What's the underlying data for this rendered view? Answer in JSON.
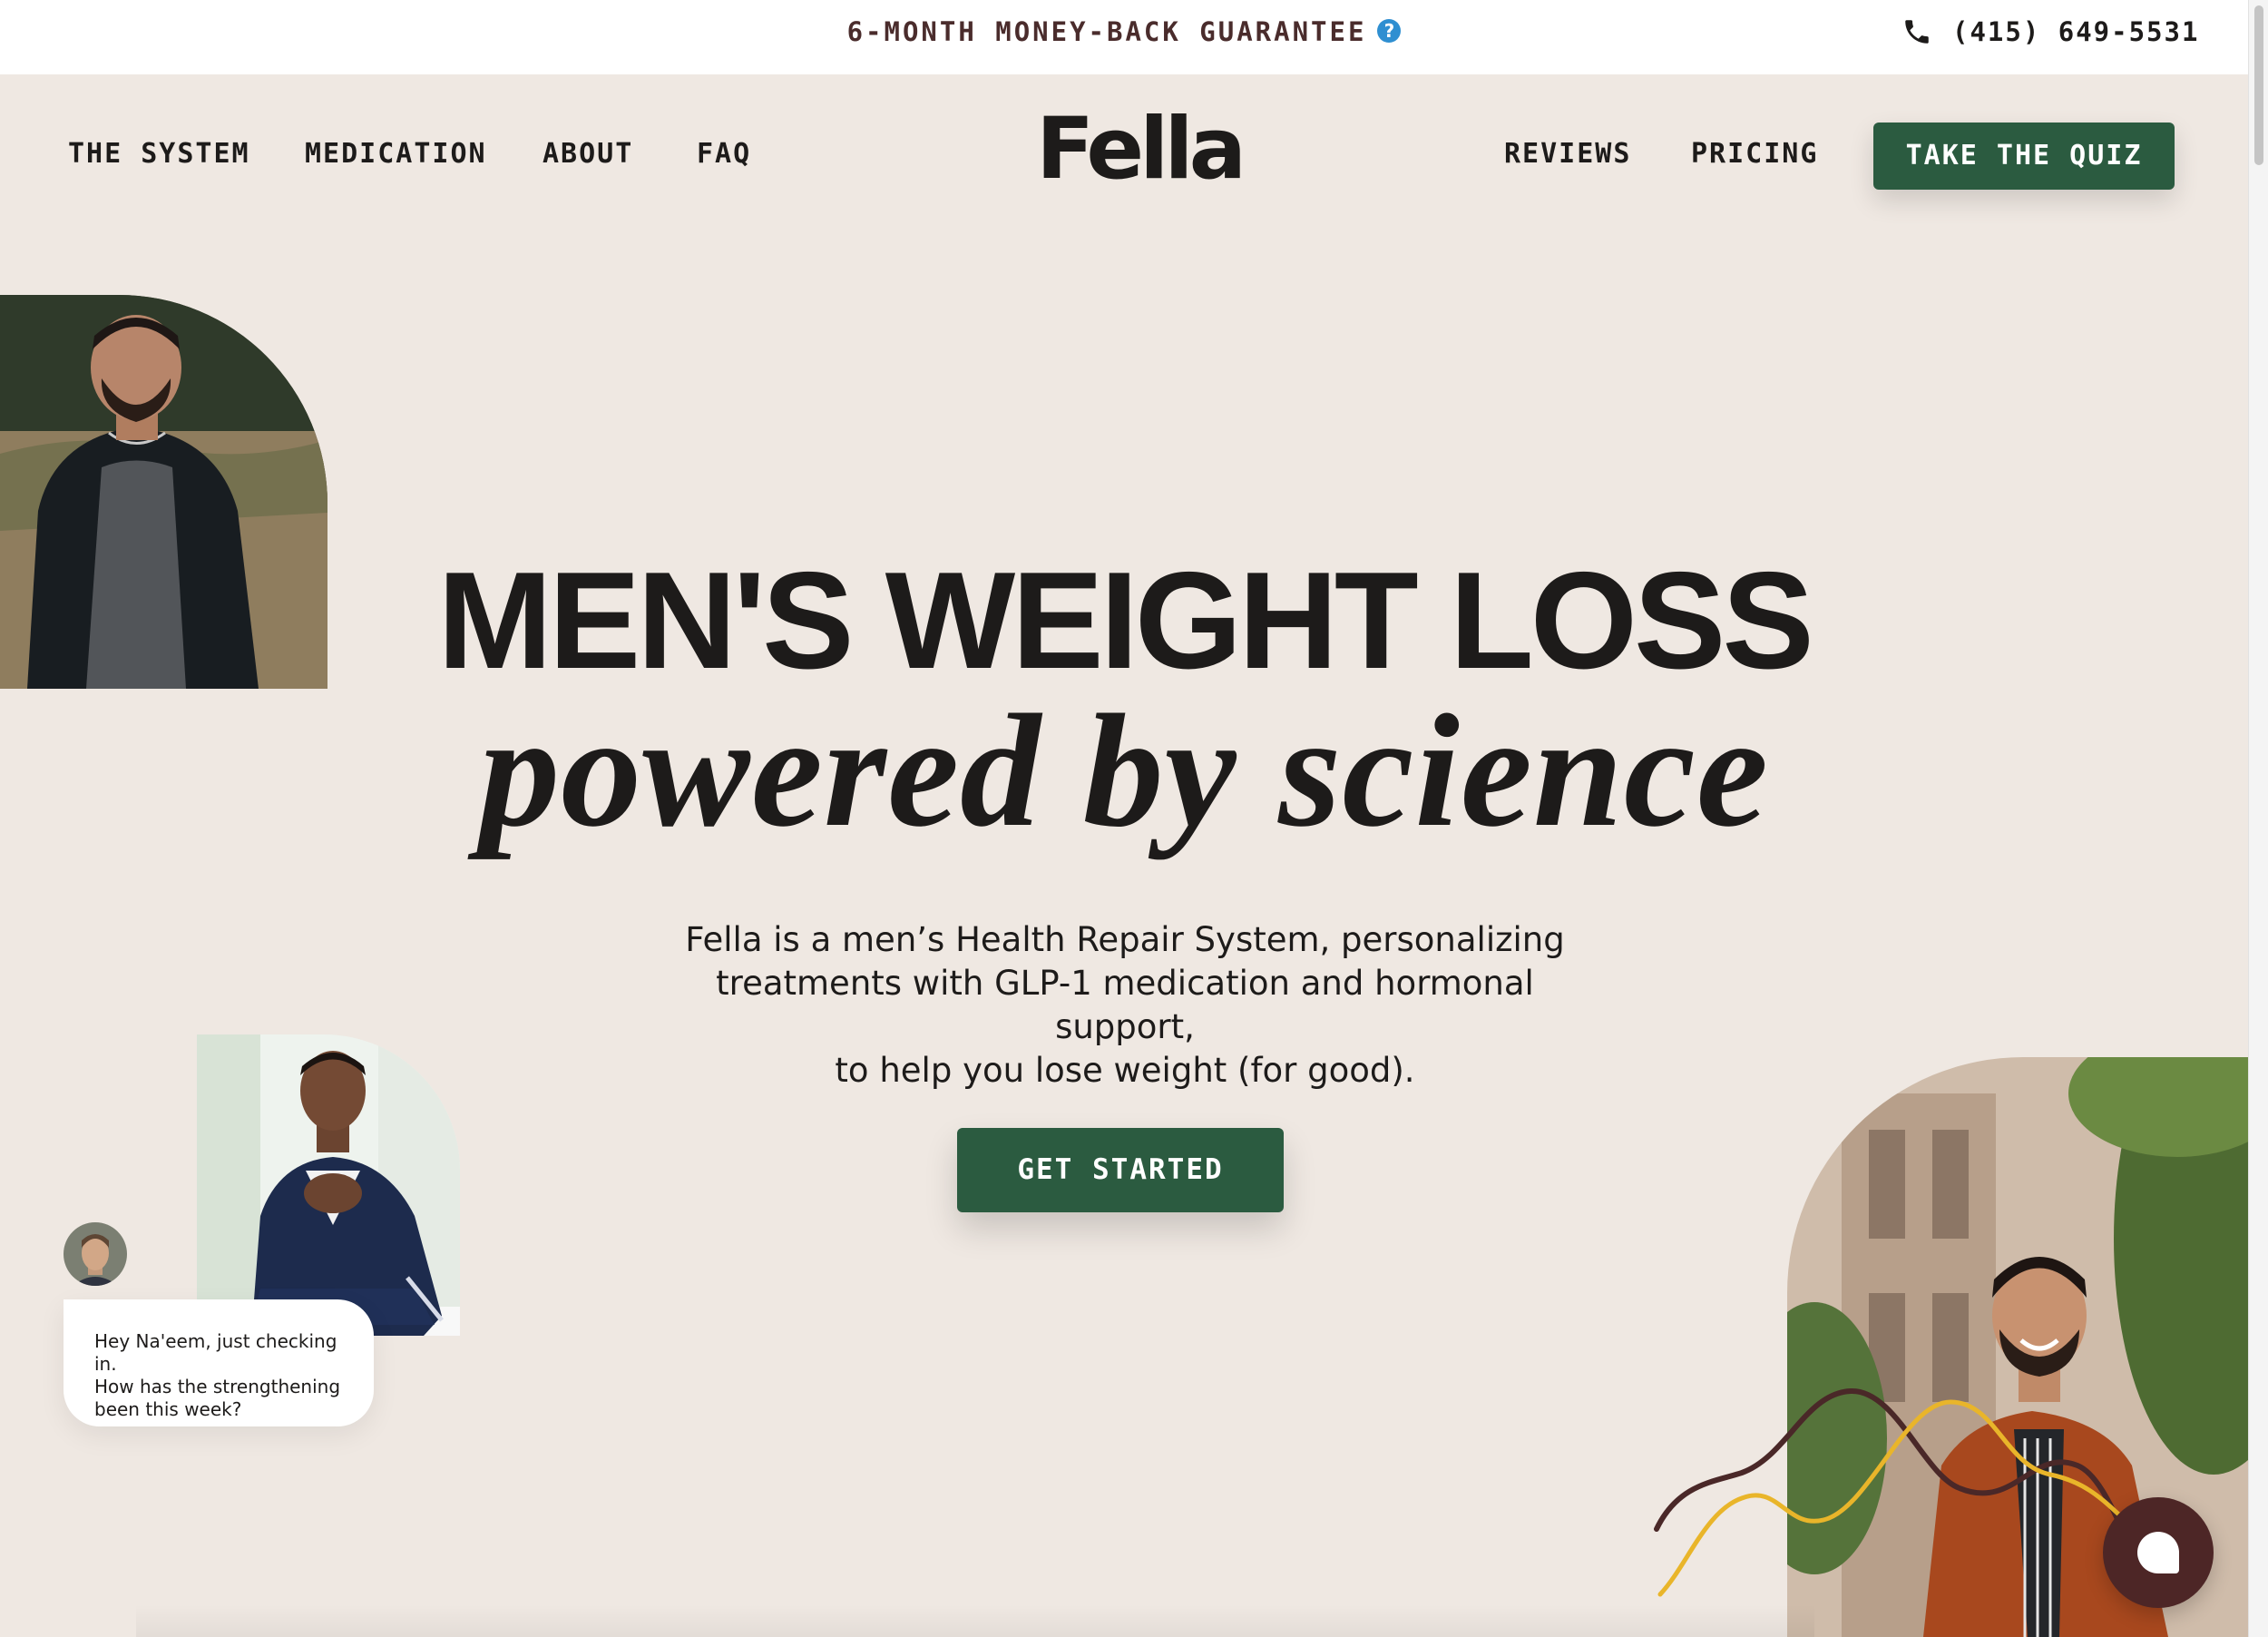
{
  "topbar": {
    "guarantee": "6-MONTH MONEY-BACK GUARANTEE",
    "help_icon": "question-circle-icon",
    "phone_icon": "phone-icon",
    "phone": "(415) 649-5531"
  },
  "nav": {
    "logo": "Fella",
    "left_links": [
      "THE SYSTEM",
      "MEDICATION",
      "ABOUT",
      "FAQ"
    ],
    "right_links": [
      "REVIEWS",
      "PRICING"
    ],
    "quiz_button": "TAKE THE QUIZ"
  },
  "hero": {
    "title": "MEN'S WEIGHT LOSS",
    "subtitle": "powered by science",
    "body_lines": [
      "Fella is a men’s Health Repair System, personalizing",
      "treatments with GLP-1 medication and hormonal support,",
      "to help you lose weight (for good)."
    ],
    "cta": "GET STARTED"
  },
  "chat_preview": {
    "lines": [
      "Hey Na'eem, just checking in.",
      "How has the strengthening",
      "been this week?"
    ]
  },
  "chat_widget": {
    "icon": "chat-bubble-icon"
  },
  "colors": {
    "background": "#efe8e2",
    "accent_green": "#2b5b40",
    "guarantee_text": "#4a2c2c",
    "help_blue": "#2f8fd1",
    "chat_fab": "#4d2626",
    "squiggle_dark": "#4a2828",
    "squiggle_gold": "#e9b52a"
  }
}
